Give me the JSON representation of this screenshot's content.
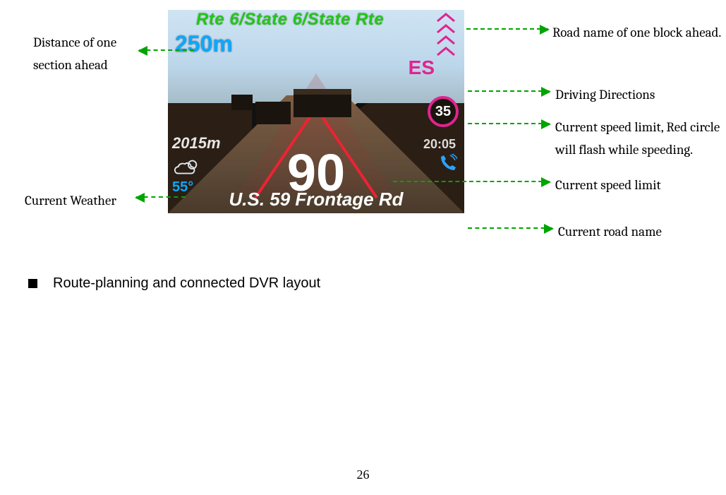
{
  "hud": {
    "route_title": "Rte 6/State 6/State Rte",
    "distance_ahead": "250m",
    "remaining": "2015m",
    "clock": "20:05",
    "speed": "90",
    "current_road": "U.S. 59 Frontage Rd",
    "heading": "ES",
    "speed_limit": "35",
    "temperature": "55°"
  },
  "callouts": {
    "distance_ahead": "Distance of one section ahead",
    "road_ahead": "Road name of one block ahead.",
    "driving_directions": "Driving Directions",
    "speed_limit": "Current speed limit, Red circle will flash while speeding.",
    "current_speed": "Current speed limit",
    "current_weather": "Current Weather",
    "current_road": "Current road name"
  },
  "heading": "Route-planning and connected DVR layout",
  "page_number": "26"
}
